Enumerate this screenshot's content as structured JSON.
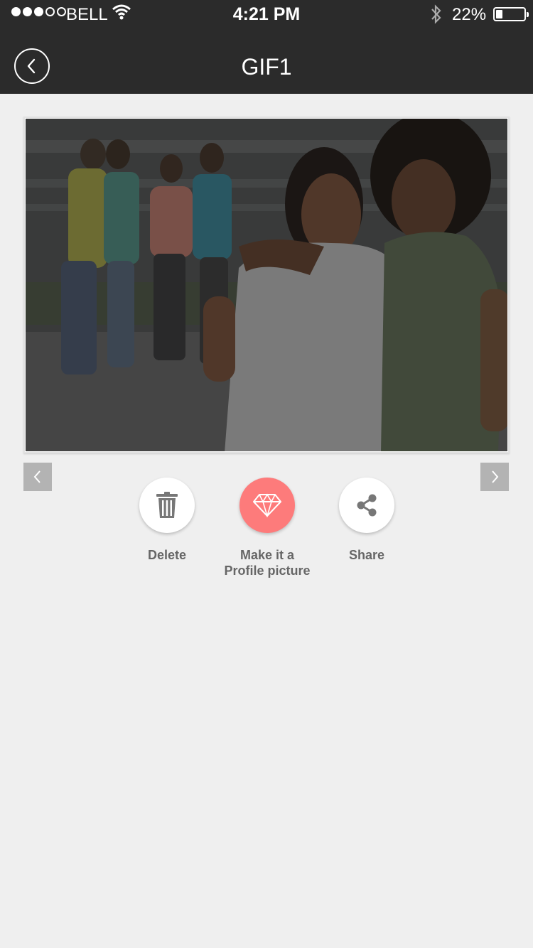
{
  "status_bar": {
    "carrier": "BELL",
    "time": "4:21 PM",
    "battery_percent": "22%",
    "battery_level": 0.22,
    "signal_bars": 3,
    "signal_total": 5
  },
  "nav": {
    "title": "GIF1",
    "back_icon": "chevron-left-icon"
  },
  "photo": {
    "description_icon": "photo-image"
  },
  "actions": [
    {
      "label": "Delete",
      "icon": "trash-icon"
    },
    {
      "label": "Make it a Profile picture",
      "label_line1": "Make it a",
      "label_line2": "Profile picture",
      "icon": "diamond-icon"
    },
    {
      "label": "Share",
      "icon": "share-icon"
    }
  ],
  "colors": {
    "header_bg": "#2b2b2b",
    "page_bg": "#efefef",
    "accent_pink": "#fd7b7b",
    "arrow_bg": "#b3b3b3"
  }
}
